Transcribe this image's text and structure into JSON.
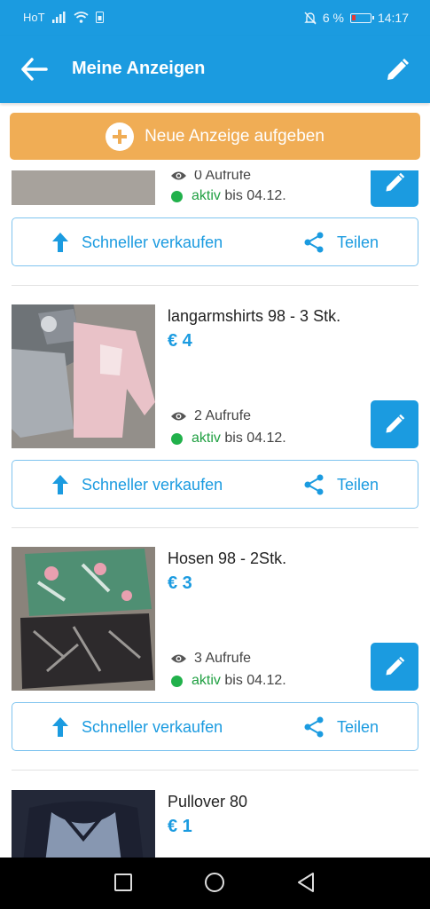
{
  "status_bar": {
    "carrier": "HoT",
    "battery_percent": "6 %",
    "time": "14:17"
  },
  "app_bar": {
    "title": "Meine Anzeigen",
    "back_icon": "arrow-left-icon",
    "edit_icon": "pencil-icon"
  },
  "new_ad_button": {
    "label": "Neue Anzeige aufgeben",
    "icon": "plus-circle-icon"
  },
  "listings": [
    {
      "title": "",
      "price": "",
      "views": "0 Aufrufe",
      "status_label": "aktiv",
      "status_until": "bis 04.12.",
      "sell_label": "Schneller verkaufen",
      "share_label": "Teilen"
    },
    {
      "title": "langarmshirts 98 - 3 Stk.",
      "price": "€ 4",
      "views": "2 Aufrufe",
      "status_label": "aktiv",
      "status_until": "bis 04.12.",
      "sell_label": "Schneller verkaufen",
      "share_label": "Teilen"
    },
    {
      "title": "Hosen 98 - 2Stk.",
      "price": "€ 3",
      "views": "3 Aufrufe",
      "status_label": "aktiv",
      "status_until": "bis 04.12.",
      "sell_label": "Schneller verkaufen",
      "share_label": "Teilen"
    },
    {
      "title": "Pullover 80",
      "price": "€ 1"
    }
  ],
  "colors": {
    "primary": "#1b9be0",
    "accent_orange": "#f0ad55",
    "active_green": "#21a043"
  },
  "nav_bar": {
    "icons": [
      "recent-apps-icon",
      "home-icon",
      "back-triangle-icon"
    ]
  }
}
